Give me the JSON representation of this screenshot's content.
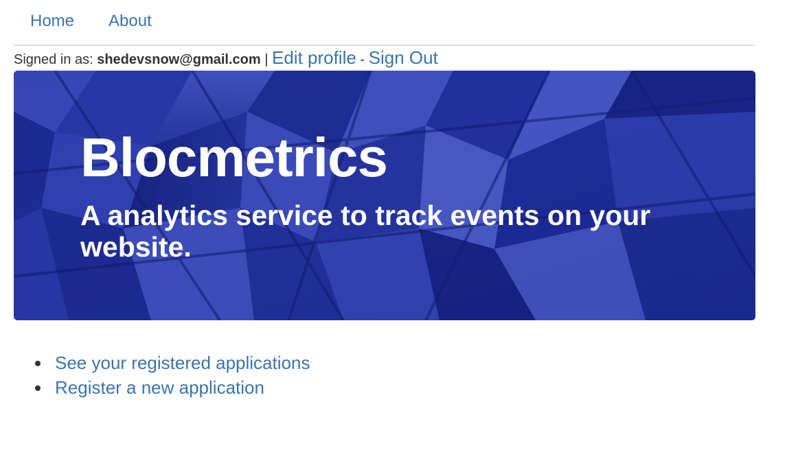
{
  "nav": {
    "items": [
      {
        "label": "Home"
      },
      {
        "label": "About"
      }
    ]
  },
  "account": {
    "prefix": "Signed in as: ",
    "email": "shedevsnow@gmail.com",
    "separator1": " | ",
    "edit_profile": "Edit profile",
    "separator2": " - ",
    "sign_out": "Sign Out"
  },
  "hero": {
    "title": "Blocmetrics",
    "subtitle": "A analytics service to track events on your website."
  },
  "links": [
    {
      "label": "See your registered applications"
    },
    {
      "label": "Register a new application"
    }
  ],
  "colors": {
    "link": "#3a74ad",
    "hero_overlay": "#1b2a8c"
  }
}
